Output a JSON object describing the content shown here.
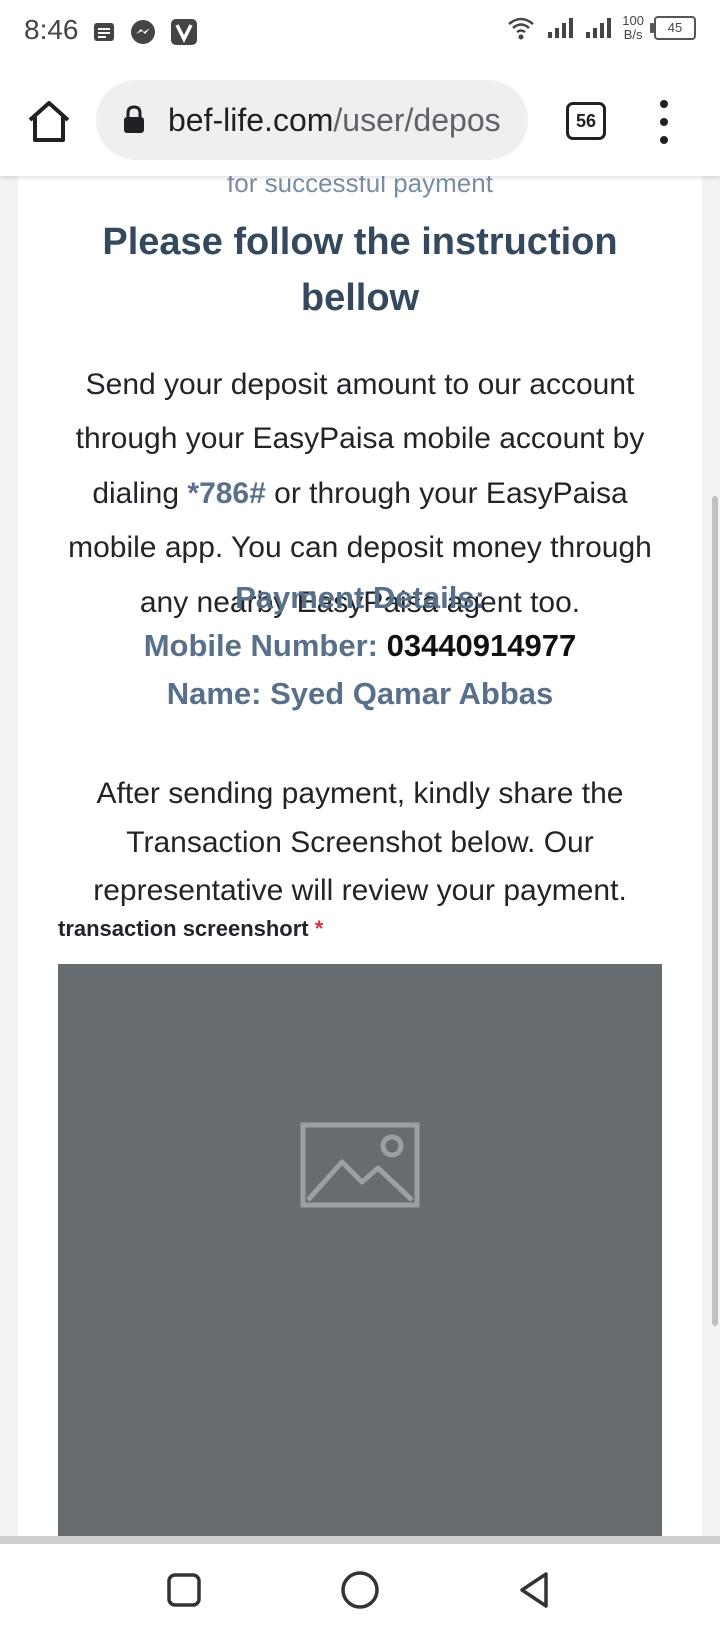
{
  "status_bar": {
    "time": "8:46",
    "notification_icons": [
      "notes-icon",
      "messenger-icon",
      "vpn-icon"
    ],
    "net_speed_value": "100",
    "net_speed_unit": "B/s",
    "battery": "45"
  },
  "browser": {
    "url_domain": "bef-life.com",
    "url_path": "/user/depos",
    "tab_count": "56"
  },
  "page": {
    "faded_text": "for successful payment",
    "heading": "Please follow the instruction bellow",
    "instructions_before": "Send your deposit amount to our account through your EasyPaisa mobile account by dialing ",
    "dial_code": "*786#",
    "instructions_after": " or through your EasyPaisa mobile app. You can deposit money through any nearby EasyPaisa agent too.",
    "payment_details_title": "Payment Details:",
    "mobile_label": "Mobile Number:",
    "mobile_number": "03440914977",
    "name_line": "Name: Syed Qamar Abbas",
    "after_payment_text": "After sending payment, kindly share the Transaction Screenshot below. Our representative will review your payment.",
    "field_label": "transaction screenshort",
    "required_mark": "*"
  },
  "colors": {
    "heading": "#34495e",
    "accent": "#5a6f8a",
    "required": "#dc3545",
    "upload_bg": "#676c71"
  }
}
